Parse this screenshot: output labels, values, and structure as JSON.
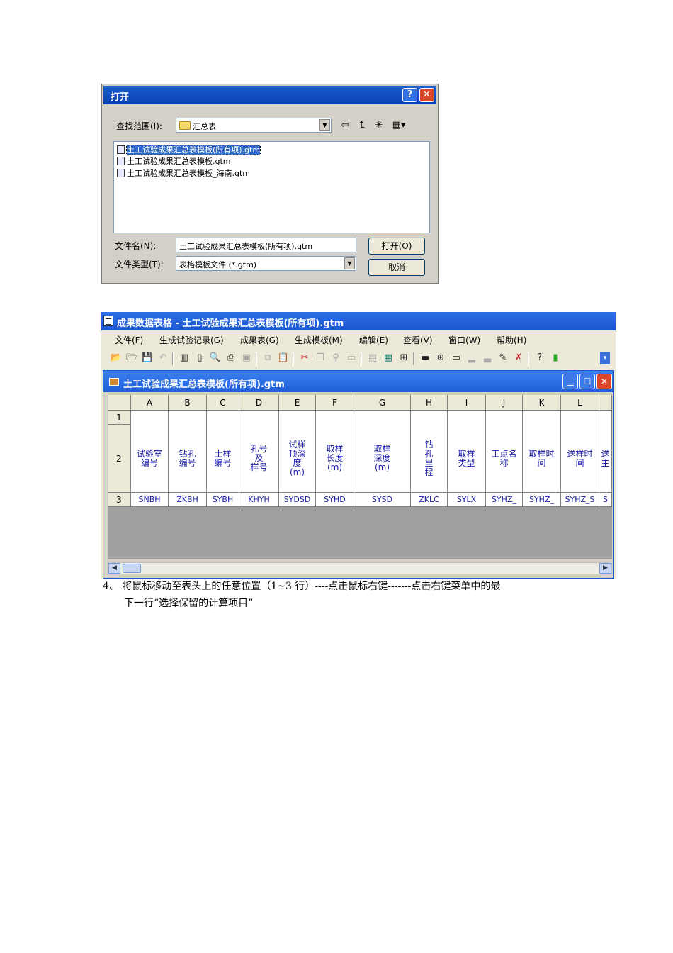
{
  "dialog": {
    "title": "打开",
    "help_label": "?",
    "close_label": "✕",
    "lookin_label": "查找范围(I):",
    "lookin_value": "汇总表",
    "files": [
      "土工试验成果汇总表模板(所有项).gtm",
      "土工试验成果汇总表模板.gtm",
      "土工试验成果汇总表模板_海南.gtm"
    ],
    "filename_label": "文件名(N):",
    "filename_value": "土工试验成果汇总表模板(所有项).gtm",
    "filetype_label": "文件类型(T):",
    "filetype_value": "表格模板文件 (*.gtm)",
    "open_button": "打开(O)",
    "cancel_button": "取消"
  },
  "app": {
    "title": "成果数据表格 - 土工试验成果汇总表模板(所有项).gtm",
    "menus": [
      "文件(F)",
      "生成试验记录(G)",
      "成果表(G)",
      "生成模板(M)",
      "编辑(E)",
      "查看(V)",
      "窗口(W)",
      "帮助(H)"
    ]
  },
  "child": {
    "title": "土工试验成果汇总表模板(所有项).gtm"
  },
  "grid": {
    "columns": [
      "A",
      "B",
      "C",
      "D",
      "E",
      "F",
      "G",
      "H",
      "I",
      "J",
      "K",
      "L",
      ""
    ],
    "row_numbers": [
      "1",
      "2",
      "3"
    ],
    "headers": [
      "试验室\n编号",
      "钻孔\n编号",
      "土样\n编号",
      "孔号\n及\n样号",
      "试样\n顶深\n度\n(m)",
      "取样\n长度\n(m)",
      "取样\n深度\n(m)",
      "钻\n孔\n里\n程",
      "取样\n类型",
      "工点名\n称",
      "取样时\n间",
      "送样时\n间",
      "送\n主"
    ],
    "fields": [
      "SNBH",
      "ZKBH",
      "SYBH",
      "KHYH",
      "SYDSD",
      "SYHD",
      "SYSD",
      "ZKLC",
      "SYLX",
      "SYHZ_",
      "SYHZ_",
      "SYHZ_S",
      "S"
    ]
  },
  "caption": {
    "line1": "4、 将鼠标移动至表头上的任意位置（1~3 行）----点击鼠标右键-------点击右键菜单中的最",
    "line2": "下一行“选择保留的计算项目”"
  }
}
